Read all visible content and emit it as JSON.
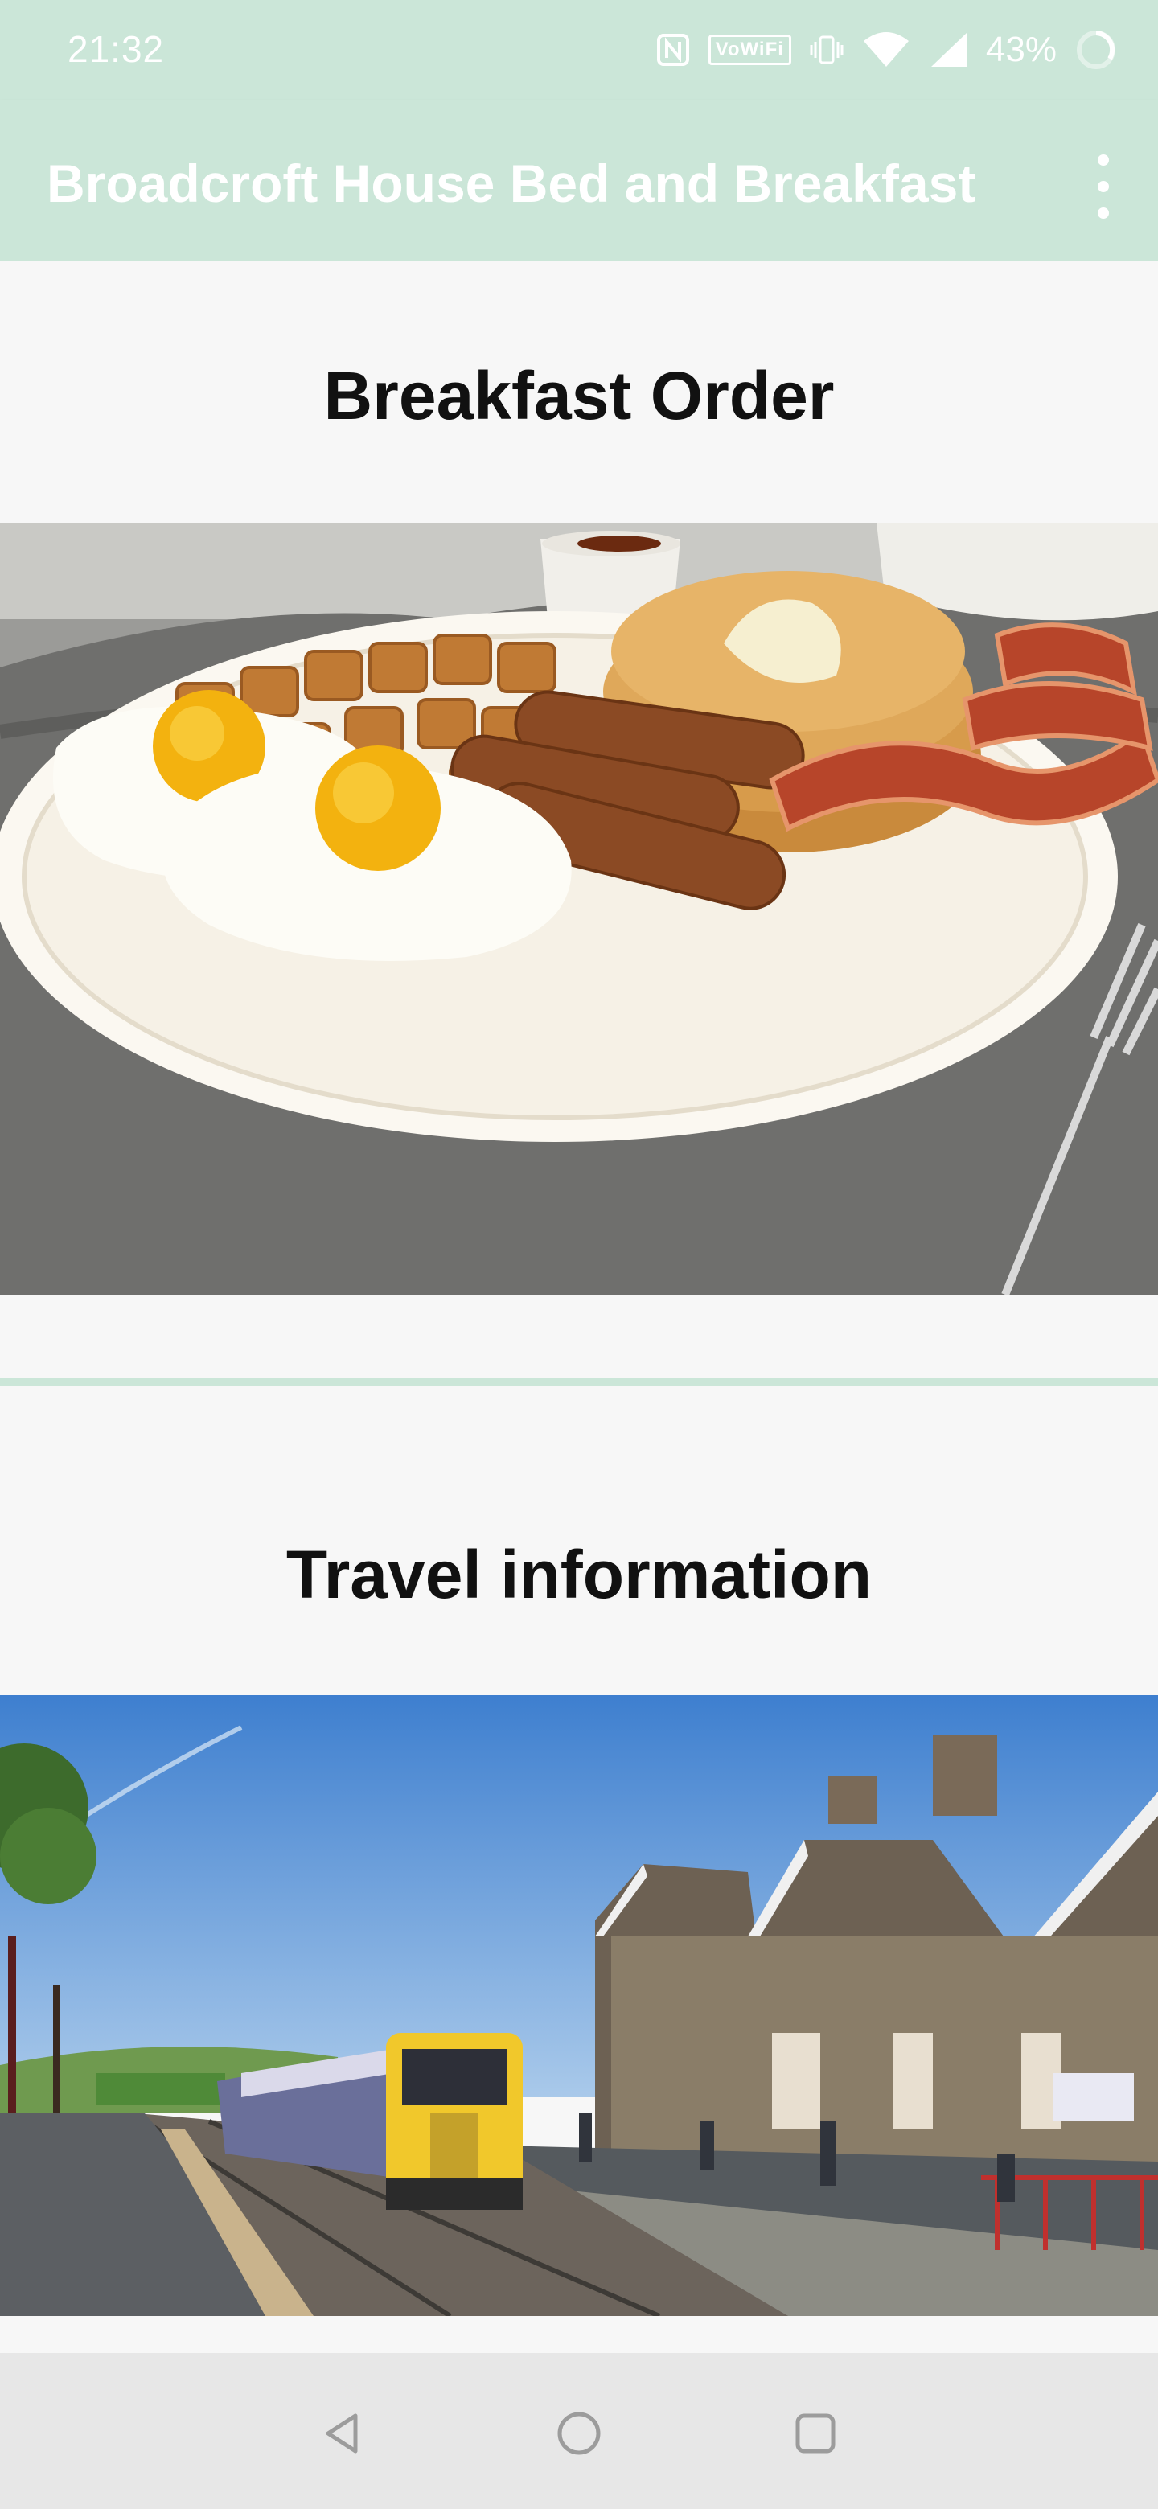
{
  "status_bar": {
    "time": "21:32",
    "wifi_label": "VoWiFi",
    "battery": "43%",
    "icons": [
      "nfc-icon",
      "vowifi-icon",
      "vibrate-icon",
      "wifi-icon",
      "signal-icon",
      "battery-icon"
    ]
  },
  "app_bar": {
    "title": "Broadcroft House Bed and Breakfast",
    "menu_icon": "more-vert-icon"
  },
  "cards": [
    {
      "title": "Breakfast Order",
      "image": "full-breakfast-plate-image"
    },
    {
      "title": "Travel information",
      "image": "railway-station-train-image"
    }
  ],
  "nav_bar": {
    "icons": [
      "back-icon",
      "home-icon",
      "recents-icon"
    ]
  },
  "colors": {
    "accent": "#cbe6d8",
    "background": "#f7f7f7",
    "title_text": "#111111"
  }
}
